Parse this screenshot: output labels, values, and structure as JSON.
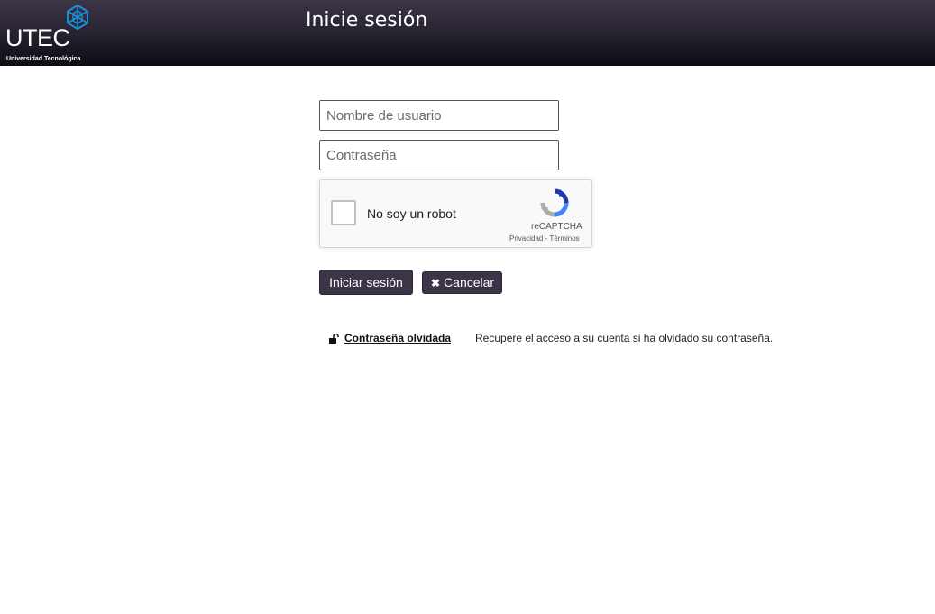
{
  "header": {
    "logo_text": "UTEC",
    "logo_subtitle": "Universidad Tecnológica",
    "logo_icon": "utec-hex-logo-icon",
    "title": "Inicie sesión",
    "brand_color": "#1a8fd6"
  },
  "form": {
    "username_placeholder": "Nombre de usuario",
    "password_placeholder": "Contraseña",
    "recaptcha": {
      "label": "No soy un robot",
      "brand": "reCAPTCHA",
      "privacy": "Privacidad",
      "separator": " - ",
      "terms": "Términos"
    },
    "login_button": "Iniciar sesión",
    "cancel_button": "Cancelar",
    "cancel_icon": "✖",
    "button_color": "#3c3548"
  },
  "forgot": {
    "icon": "unlock-icon",
    "link_label": "Contraseña olvidada",
    "description": "Recupere el acceso a su cuenta si ha olvidado su contraseña."
  }
}
